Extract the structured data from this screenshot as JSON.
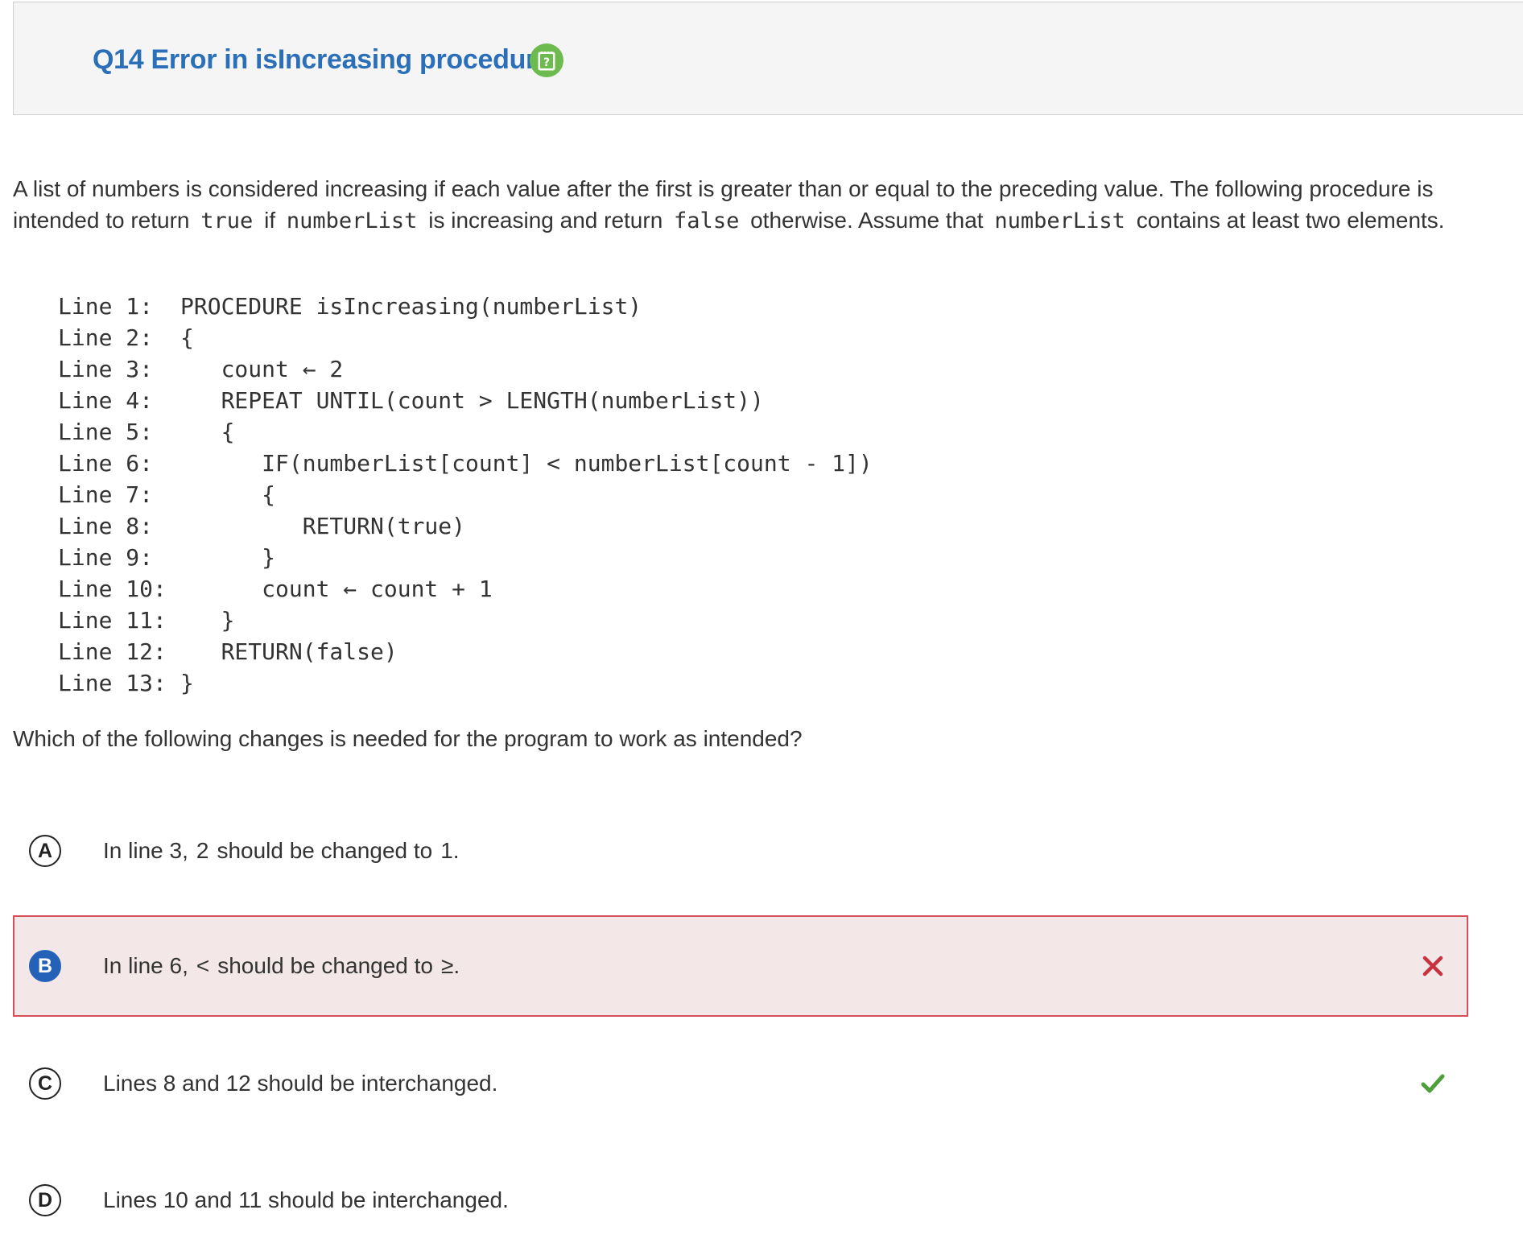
{
  "header": {
    "title": "Q14 Error in isIncreasing procedure",
    "help_icon": "question-notepad-icon"
  },
  "prompt": {
    "p1": "A list of numbers is considered increasing if each value after the first is greater than or equal to the preceding value. The following procedure is intended to return ",
    "code1": "true",
    "p2": " if ",
    "code2": "numberList",
    "p3": " is increasing and return ",
    "code3": "false",
    "p4": " otherwise. Assume that ",
    "code4": "numberList",
    "p5": " contains at least two elements."
  },
  "code": {
    "lines": [
      {
        "num": "Line 1:",
        "text": "PROCEDURE isIncreasing(numberList)"
      },
      {
        "num": "Line 2:",
        "text": "{"
      },
      {
        "num": "Line 3:",
        "text": "   count ← 2"
      },
      {
        "num": "Line 4:",
        "text": "   REPEAT UNTIL(count > LENGTH(numberList))"
      },
      {
        "num": "Line 5:",
        "text": "   {"
      },
      {
        "num": "Line 6:",
        "text": "      IF(numberList[count] < numberList[count - 1])"
      },
      {
        "num": "Line 7:",
        "text": "      {"
      },
      {
        "num": "Line 8:",
        "text": "         RETURN(true)"
      },
      {
        "num": "Line 9:",
        "text": "      }"
      },
      {
        "num": "Line 10:",
        "text": "      count ← count + 1"
      },
      {
        "num": "Line 11:",
        "text": "   }"
      },
      {
        "num": "Line 12:",
        "text": "   RETURN(false)"
      },
      {
        "num": "Line 13:",
        "text": "}"
      }
    ]
  },
  "question": "Which of the following changes is needed for the program to work as intended?",
  "choices": [
    {
      "letter": "A",
      "pre": "In line 3,",
      "code_a": "2",
      "mid": "should be changed to",
      "code_b": "1",
      "post": ".",
      "state": "none"
    },
    {
      "letter": "B",
      "pre": "In line 6,",
      "code_a": "<",
      "mid": "should be changed to",
      "code_b": "≥",
      "post": ".",
      "state": "selected-incorrect",
      "mark_icon": "x-icon",
      "mark_color": "#c8323f"
    },
    {
      "letter": "C",
      "text": "Lines 8 and 12 should be interchanged.",
      "state": "correct",
      "mark_icon": "check-icon",
      "mark_color": "#4e9e3a"
    },
    {
      "letter": "D",
      "text": "Lines 10 and 11 should be interchanged.",
      "state": "none"
    }
  ],
  "colors": {
    "title": "#2b6fb8",
    "selected_letter": "#2461b8",
    "incorrect_border": "#d74e5b",
    "incorrect_bg": "#f3e7e7",
    "help_badge": "#6dbb4e"
  }
}
